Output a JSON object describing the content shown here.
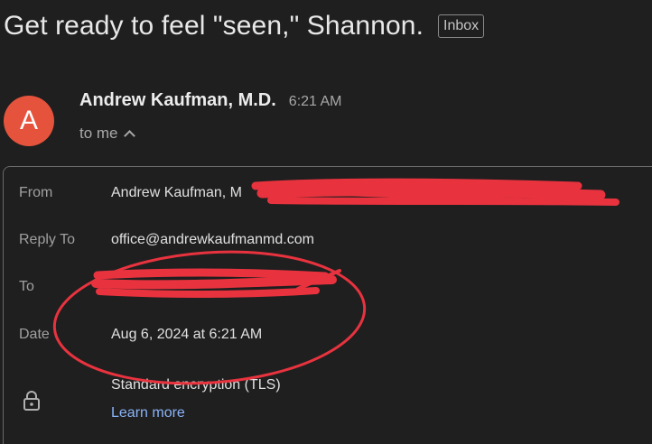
{
  "email": {
    "subject": "Get ready to feel \"seen,\" Shannon.",
    "label": "Inbox",
    "avatar_letter": "A",
    "avatar_color": "#e6533c",
    "sender_name": "Andrew Kaufman, M.D.",
    "sent_time": "6:21 AM",
    "recipient_summary": "to me"
  },
  "details": {
    "from_label": "From",
    "from_value": "Andrew Kaufman, M",
    "reply_to_label": "Reply To",
    "reply_to_value": "office@andrewkaufmanmd.com",
    "to_label": "To",
    "date_label": "Date",
    "date_value": "Aug 6, 2024 at 6:21 AM",
    "security_text": "Standard encryption (TLS)",
    "learn_more": "Learn more"
  },
  "icons": {
    "chevron": "chevron-up-icon",
    "lock": "lock-icon"
  },
  "annotation_color": "#e8333f"
}
